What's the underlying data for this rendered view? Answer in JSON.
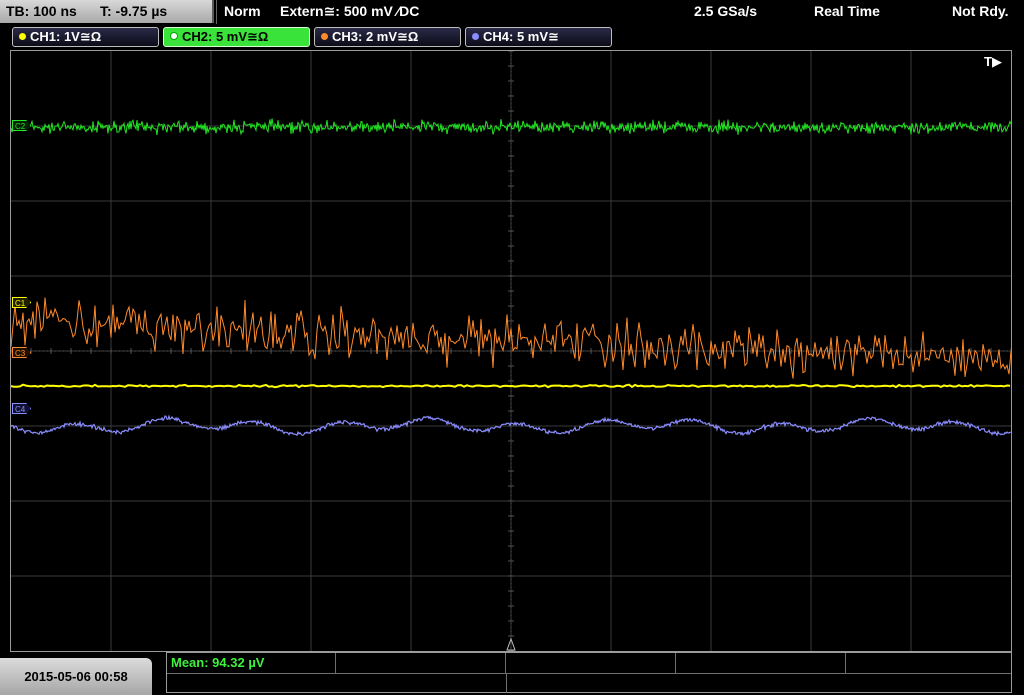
{
  "topbar": {
    "timebase": "TB: 100 ns",
    "trigger_time": "T: -9.75 µs",
    "trigger_mode": "Norm",
    "trigger_source": "Extern≅: 500 mV ⁄DC",
    "sample_rate": "2.5 GSa/s",
    "acq_mode": "Real Time",
    "status": "Not Rdy."
  },
  "channels": [
    {
      "label": "CH1: 1V≅Ω",
      "color": "#ffff00",
      "marker": "C1"
    },
    {
      "label": "CH2: 5 mV≅Ω",
      "color": "#22e622",
      "marker": "C2"
    },
    {
      "label": "CH3: 2 mV≅Ω",
      "color": "#ff8a2b",
      "marker": "C3"
    },
    {
      "label": "CH4: 5 mV≅",
      "color": "#8a8cff",
      "marker": "C4"
    }
  ],
  "trigger_marker": "T▶",
  "bottom": {
    "date": "2015-05-06 00:58",
    "mean": "Mean: 94.32 µV"
  }
}
